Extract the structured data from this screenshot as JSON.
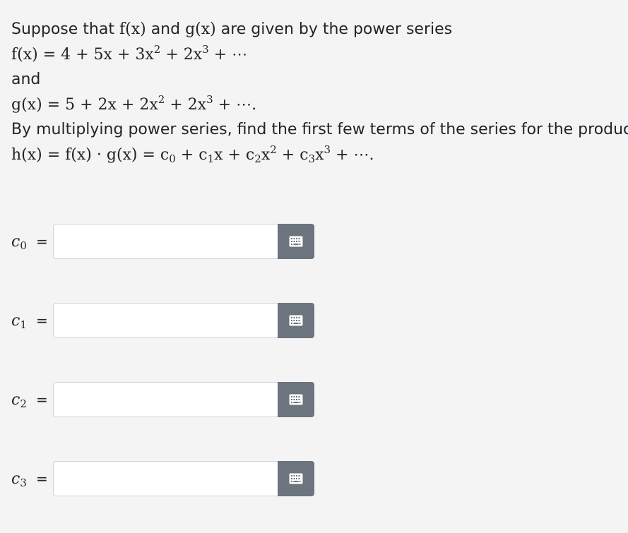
{
  "problem": {
    "intro": "Suppose that",
    "f_x": "f(x)",
    "and_word": "and",
    "g_x": "g(x)",
    "intro_tail": "are given by the power series",
    "f_series_lhs": "f(x) = 4 + 5x + 3x",
    "f_series_exp1": "2",
    "f_series_mid": " + 2x",
    "f_series_exp2": "3",
    "f_series_tail": " + ⋯",
    "and_line": "and",
    "g_series_lhs": "g(x) = 5 + 2x + 2x",
    "g_series_exp1": "2",
    "g_series_mid": " + 2x",
    "g_series_exp2": "3",
    "g_series_tail": " + ⋯.",
    "instruction": "By multiplying power series, find the first few terms of the series for the product",
    "h_series_a": "h(x) = f(x) · g(x) = c",
    "h_sub0": "0",
    "h_series_b": " + c",
    "h_sub1": "1",
    "h_series_c": "x + c",
    "h_sub2": "2",
    "h_series_d": "x",
    "h_exp2": "2",
    "h_series_e": " + c",
    "h_sub3": "3",
    "h_series_f": "x",
    "h_exp3": "3",
    "h_series_g": " + ⋯."
  },
  "answers": [
    {
      "var": "c",
      "sub": "0",
      "eq": "=",
      "value": ""
    },
    {
      "var": "c",
      "sub": "1",
      "eq": "=",
      "value": ""
    },
    {
      "var": "c",
      "sub": "2",
      "eq": "=",
      "value": ""
    },
    {
      "var": "c",
      "sub": "3",
      "eq": "=",
      "value": ""
    }
  ],
  "icons": {
    "math_keyboard": "keyboard-icon"
  },
  "colors": {
    "background": "#f4f4f4",
    "button": "#6c757d",
    "input_border": "#ced4da"
  }
}
